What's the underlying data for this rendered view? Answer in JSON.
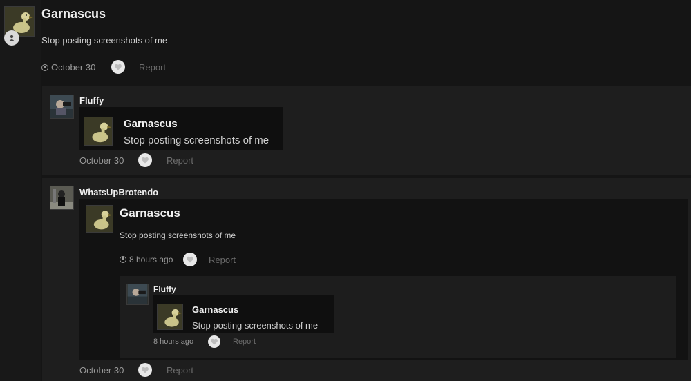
{
  "post": {
    "author": "Garnascus",
    "body": "Stop posting screenshots of me",
    "date": "October 30",
    "report": "Report"
  },
  "reply1": {
    "author": "Fluffy",
    "quote": {
      "author": "Garnascus",
      "body": "Stop posting screenshots of me"
    },
    "date": "October 30",
    "report": "Report"
  },
  "reply2": {
    "author": "WhatsUpBrotendo",
    "embed": {
      "author": "Garnascus",
      "body": "Stop posting screenshots of me",
      "time": "8 hours ago",
      "report": "Report",
      "nested": {
        "author": "Fluffy",
        "quote": {
          "author": "Garnascus",
          "body": "Stop posting screenshots of me"
        },
        "time": "8 hours ago",
        "report": "Report"
      }
    },
    "date": "October 30",
    "report": "Report"
  },
  "colors": {
    "background": "#151515",
    "panel": "#1e1e1e",
    "quote": "#0f0f0f",
    "heart": "#e8e8e8"
  },
  "icons": [
    "user-icon",
    "clock-icon",
    "heart-icon"
  ]
}
